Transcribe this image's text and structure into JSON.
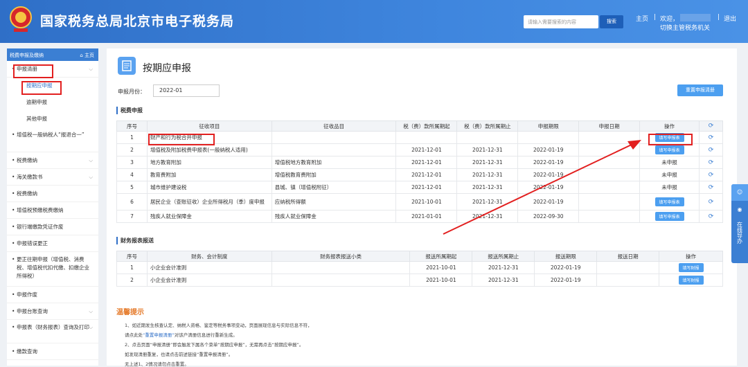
{
  "header": {
    "site_title": "国家税务总局北京市电子税务局",
    "search_placeholder": "请输入需要搜索的内容",
    "search_button": "搜索",
    "home_link": "主页",
    "welcome": "欢迎，",
    "switch_authority": "切换主管税务机关",
    "logout": "退出",
    "emblem_text": "税务总局"
  },
  "sidebar": {
    "header_label": "税费申报及缴纳",
    "home_label": "主页",
    "items": [
      {
        "label": "申报清册"
      },
      {
        "label": "增值税一般纳税人“报退合一”"
      },
      {
        "label": "税费缴纳"
      },
      {
        "label": "海关缴款书"
      },
      {
        "label": "税费缴纳"
      },
      {
        "label": "增值税预缴税费缴纳"
      },
      {
        "label": "银行端缴款凭证作废"
      },
      {
        "label": "申报错误更正"
      },
      {
        "label": "更正往期申报（增值税、消费税、增值税代扣代缴、扣缴企业所得税）"
      },
      {
        "label": "申报作废"
      },
      {
        "label": "申报台账查询"
      },
      {
        "label": "申报表（财务报表）查询及打印"
      },
      {
        "label": "缴款查询"
      }
    ],
    "sub_items": [
      "按期应申报",
      "逾期申报",
      "其他申报"
    ]
  },
  "main": {
    "page_title": "按期应申报",
    "month_label": "申报月份：",
    "month_value": "2022-01",
    "reset_button": "重置申报清册",
    "tax_section_title": "税费申报",
    "tax_table": {
      "headers": [
        "序号",
        "征收项目",
        "征收品目",
        "税（费）款所属期起",
        "税（费）款所属期止",
        "申报期限",
        "申报日期",
        "操作"
      ],
      "rows": [
        {
          "no": "1",
          "item": "财产和行为税合并申报",
          "sub": "",
          "start": "",
          "end": "",
          "deadline": "",
          "date": "",
          "op": "填写申报表"
        },
        {
          "no": "2",
          "item": "增值税及附加税费申报表(一般纳税人适用)",
          "sub": "",
          "start": "2021-12-01",
          "end": "2021-12-31",
          "deadline": "2022-01-19",
          "date": "",
          "op": "填写申报表"
        },
        {
          "no": "3",
          "item": "地方教育附加",
          "sub": "增值税地方教育附加",
          "start": "2021-12-01",
          "end": "2021-12-31",
          "deadline": "2022-01-19",
          "date": "",
          "op": "未申报"
        },
        {
          "no": "4",
          "item": "教育费附加",
          "sub": "增值税教育费附加",
          "start": "2021-12-01",
          "end": "2021-12-31",
          "deadline": "2022-01-19",
          "date": "",
          "op": "未申报"
        },
        {
          "no": "5",
          "item": "城市维护建设税",
          "sub": "县城、镇（增值税附征）",
          "start": "2021-12-01",
          "end": "2021-12-31",
          "deadline": "2022-01-19",
          "date": "",
          "op": "未申报"
        },
        {
          "no": "6",
          "item": "居民企业（查账征收）企业所得税月（季）度申报",
          "sub": "应纳税所得额",
          "start": "2021-10-01",
          "end": "2021-12-31",
          "deadline": "2022-01-19",
          "date": "",
          "op": "填写申报表"
        },
        {
          "no": "7",
          "item": "残疾人就业保障金",
          "sub": "残疾人就业保障金",
          "start": "2021-01-01",
          "end": "2021-12-31",
          "deadline": "2022-09-30",
          "date": "",
          "op": "填写申报表"
        }
      ]
    },
    "fin_section_title": "财务报表报送",
    "fin_table": {
      "headers": [
        "序号",
        "财务、会计制度",
        "财务报表报送小类",
        "报送所属期起",
        "报送所属期止",
        "报送期限",
        "报送日期",
        "操作"
      ],
      "rows": [
        {
          "no": "1",
          "system": "小企业会计准则",
          "sub": "",
          "start": "2021-10-01",
          "end": "2021-12-31",
          "deadline": "2022-01-19",
          "date": "",
          "op": "填写财报"
        },
        {
          "no": "2",
          "system": "小企业会计准则",
          "sub": "",
          "start": "2021-10-01",
          "end": "2021-12-31",
          "deadline": "2022-01-19",
          "date": "",
          "op": "填写财报"
        }
      ]
    },
    "tips_title": "温馨提示",
    "tips": [
      "1、如近期发生核查认定、纳税人资格、鉴定等税务事项变动，页面展现信息与实际信息不符，",
      "请点此处",
      "“重置申报清册”",
      "对该户清册信息进行重新生成。",
      "2、点击页面“申报清册”即会触发下属各个菜单“按期应申报”，无需再点击“按期应申报”。",
      "如发现清册重复，也请点击前述链接“重置申报清册”。",
      "无上述1、2情况请勿点击重置。"
    ]
  },
  "float_widget": {
    "label": "在线导办"
  }
}
